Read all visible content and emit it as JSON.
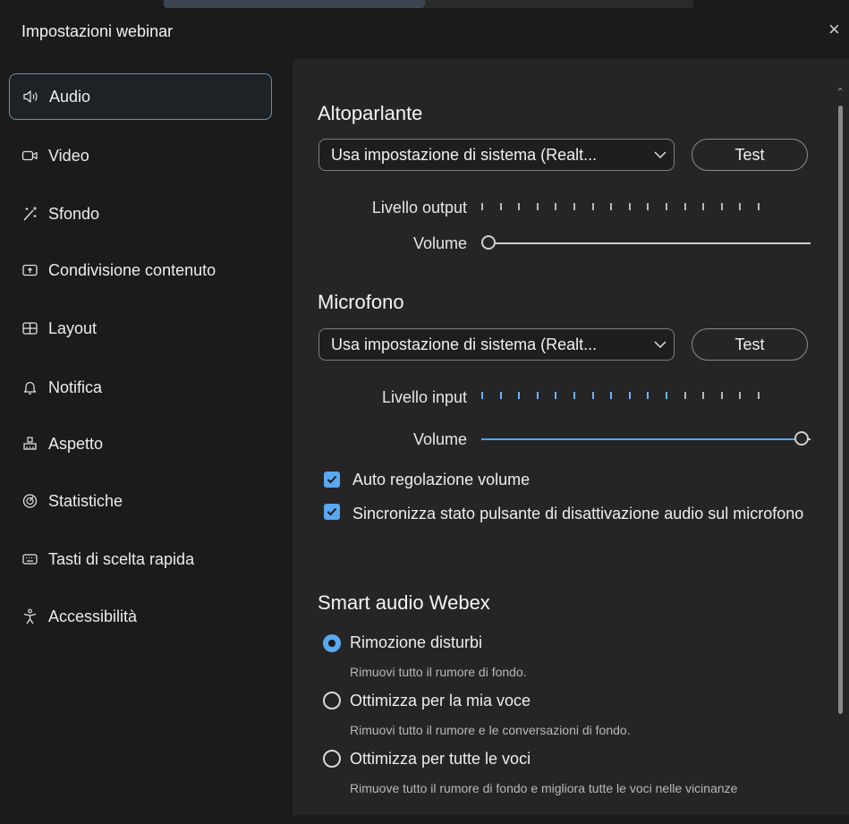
{
  "dialog": {
    "title": "Impostazioni webinar",
    "close": "×"
  },
  "nav": [
    {
      "label": "Audio",
      "icon": "speaker-icon",
      "active": true
    },
    {
      "label": "Video",
      "icon": "video-camera-icon"
    },
    {
      "label": "Sfondo",
      "icon": "magic-wand-icon"
    },
    {
      "label": "Condivisione contenuto",
      "icon": "share-screen-icon"
    },
    {
      "label": "Layout",
      "icon": "layout-grid-icon"
    },
    {
      "label": "Notifica",
      "icon": "bell-icon"
    },
    {
      "label": "Aspetto",
      "icon": "brush-icon"
    },
    {
      "label": "Statistiche",
      "icon": "stats-gauge-icon"
    },
    {
      "label": "Tasti di scelta rapida",
      "icon": "keyboard-icon"
    },
    {
      "label": "Accessibilità",
      "icon": "accessibility-icon"
    }
  ],
  "speaker": {
    "heading": "Altoparlante",
    "device": "Usa impostazione di sistema (Realt...",
    "test": "Test",
    "level_label": "Livello output",
    "level_active_ticks": 0,
    "level_total_ticks": 16,
    "volume_label": "Volume",
    "volume": 0.0
  },
  "microphone": {
    "heading": "Microfono",
    "device": "Usa impostazione di sistema (Realt...",
    "test": "Test",
    "level_label": "Livello input",
    "level_active_ticks": 11,
    "level_total_ticks": 16,
    "volume_label": "Volume",
    "volume": 1.0
  },
  "checkboxes": {
    "auto_volume": "Auto regolazione volume",
    "sync_mute": "Sincronizza stato pulsante di disattivazione audio sul microfono"
  },
  "smart_audio": {
    "heading": "Smart audio Webex",
    "options": [
      {
        "label": "Rimozione disturbi",
        "desc": "Rimuovi tutto il rumore di fondo.",
        "selected": true
      },
      {
        "label": "Ottimizza per la mia voce",
        "desc": "Rimuovi tutto il rumore e le conversazioni di fondo.",
        "selected": false
      },
      {
        "label": "Ottimizza per tutte le voci",
        "desc": "Rimuove tutto il rumore di fondo e migliora tutte le voci nelle vicinanze",
        "selected": false
      }
    ]
  },
  "colors": {
    "accent": "#5aa8f0",
    "panel": "#252525",
    "background": "#1b1b1b"
  }
}
